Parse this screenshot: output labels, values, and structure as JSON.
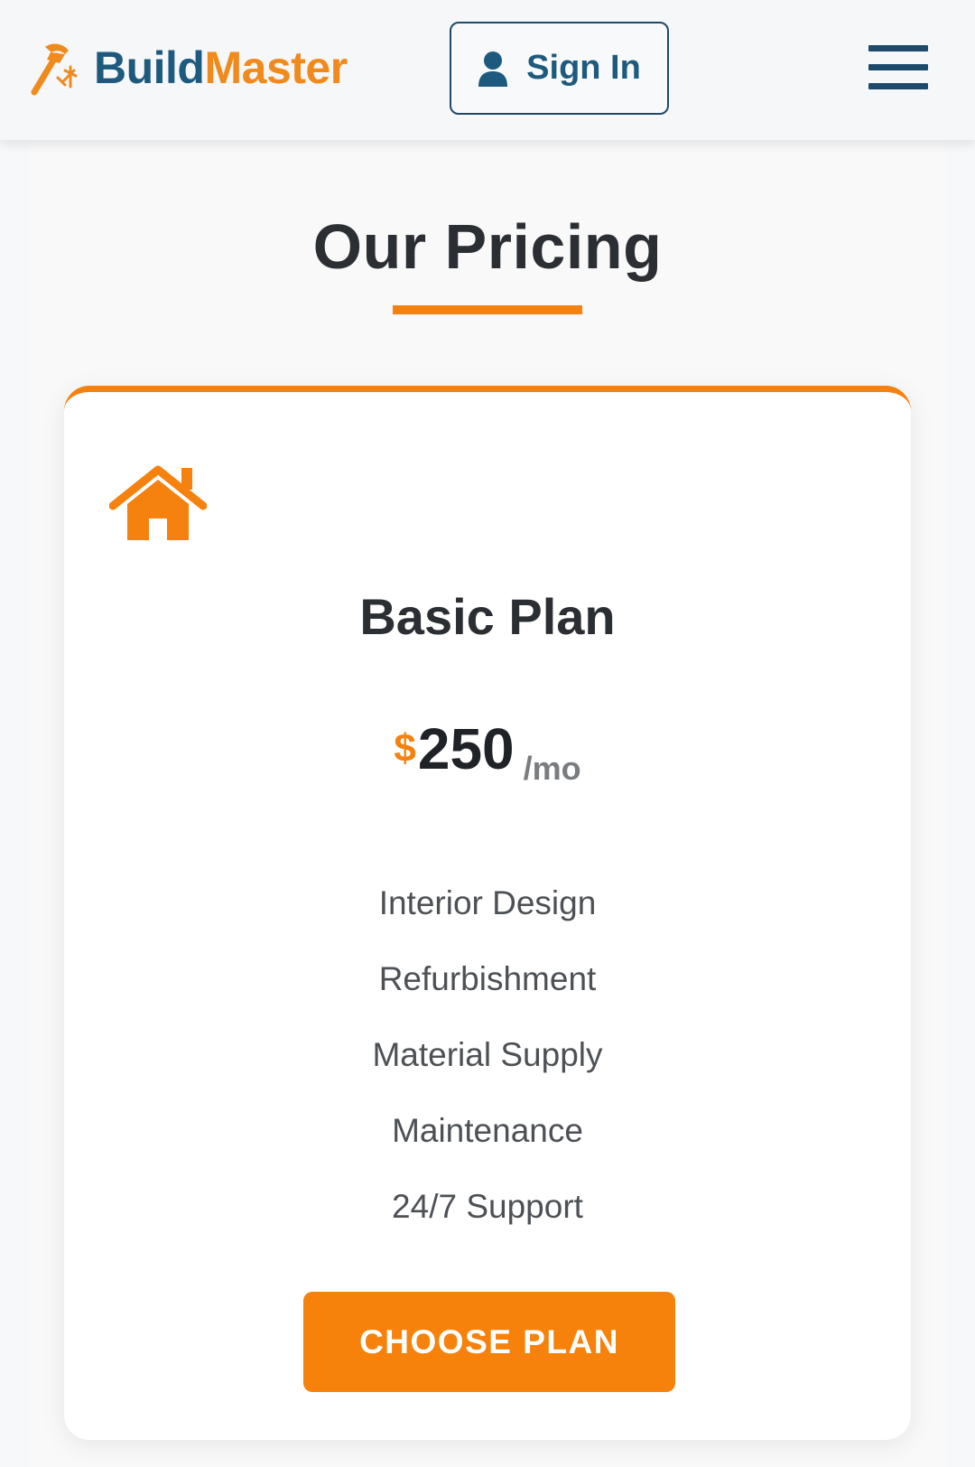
{
  "header": {
    "brand_part1": "Build",
    "brand_part2": "Master",
    "sign_in_label": "Sign In"
  },
  "pricing": {
    "heading": "Our Pricing",
    "plan": {
      "name": "Basic Plan",
      "currency": "$",
      "price": "250",
      "period": "/mo",
      "features": [
        "Interior Design",
        "Refurbishment",
        "Material Supply",
        "Maintenance",
        "24/7 Support"
      ],
      "cta_label": "CHOOSE PLAN"
    }
  },
  "icons": {
    "logo": "hammer-nail-icon",
    "sign_in": "user-icon",
    "menu": "hamburger-menu-icon",
    "plan": "house-icon"
  },
  "colors": {
    "brand_blue": "#1d5a7e",
    "accent_orange": "#f5820f",
    "text_dark": "#2b2f33",
    "text_muted": "#4d5155"
  }
}
